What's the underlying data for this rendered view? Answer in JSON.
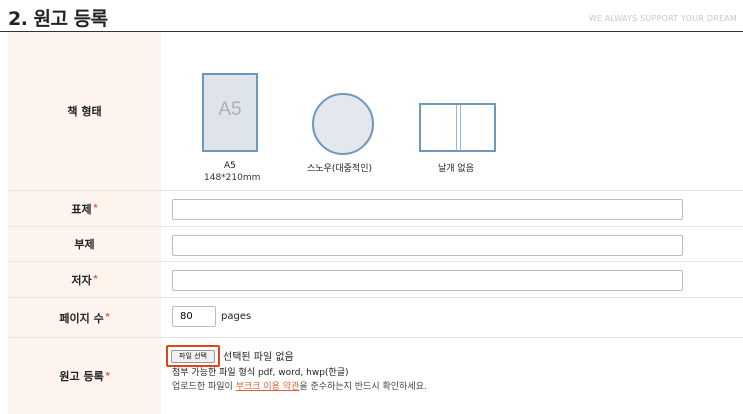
{
  "header": {
    "title": "2. 원고 등록",
    "slogan": "WE ALWAYS SUPPORT YOUR DREAM"
  },
  "form": {
    "required_mark": "*",
    "book_type": {
      "label": "책 형태",
      "options": [
        {
          "label": "A5",
          "sub": "148*210mm",
          "icon_text": "A5"
        },
        {
          "label": "스노우(대중적인)"
        },
        {
          "label": "날개 없음"
        }
      ]
    },
    "cover": {
      "label": "표제",
      "value": ""
    },
    "subtitle": {
      "label": "부제",
      "value": ""
    },
    "author": {
      "label": "저자",
      "value": ""
    },
    "page_count": {
      "label": "페이지 수",
      "value": "80",
      "unit": "pages"
    },
    "manuscript": {
      "label": "원고 등록",
      "button_label": "파일 선택",
      "no_file_text": "선택된 파일 없음",
      "file_types_text": "첨부 가능한 파일 형식 pdf, word, hwp(한글)",
      "notice_prefix": "업로드한 파일이 ",
      "notice_link": "부크크 이용 약관",
      "notice_suffix": "을 준수하는지 반드시 확인하세요."
    }
  },
  "colors": {
    "accent": "#e0623a",
    "label_bg": "#fdf4ee",
    "shape_border": "#6e97bd",
    "highlight": "#e0441c"
  }
}
